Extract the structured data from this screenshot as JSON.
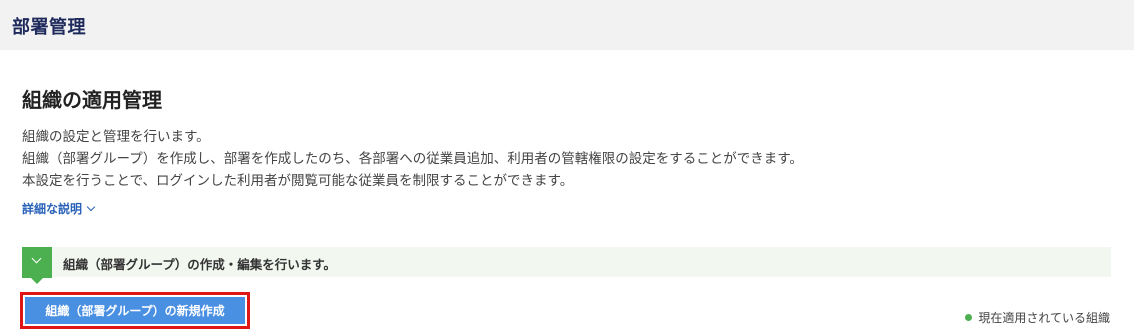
{
  "header": {
    "title": "部署管理"
  },
  "section": {
    "title": "組織の適用管理",
    "description": [
      "組織の設定と管理を行います。",
      "組織（部署グループ）を作成し、部署を作成したのち、各部署への従業員追加、利用者の管轄権限の設定をすることができます。",
      "本設定を行うことで、ログインした利用者が閲覧可能な従業員を制限することができます。"
    ],
    "details_link": "詳細な説明"
  },
  "notice": {
    "text": "組織（部署グループ）の作成・編集を行います。"
  },
  "create_button": {
    "label": "組織（部署グループ）の新規作成"
  },
  "legend": {
    "label": "現在適用されている組織",
    "color": "#4caf50"
  },
  "colors": {
    "accent": "#4a90e2",
    "highlight_border": "#e01515",
    "notice": "#4caf50"
  }
}
